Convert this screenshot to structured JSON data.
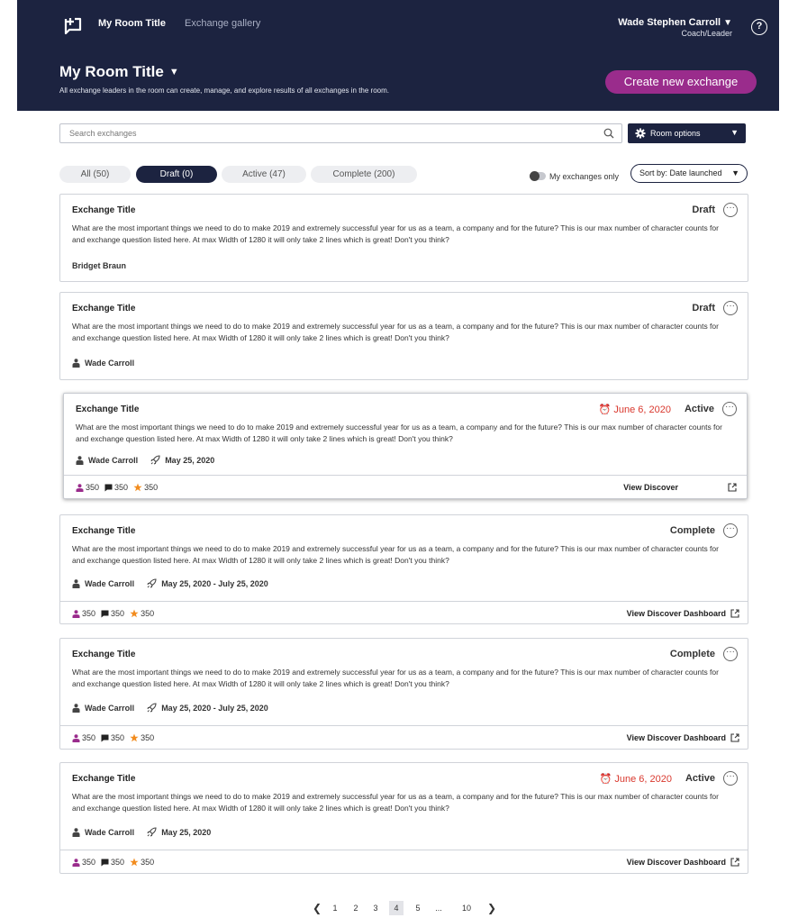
{
  "header": {
    "nav_room": "My Room Title",
    "nav_gallery": "Exchange gallery",
    "user_name": "Wade Stephen Carroll",
    "user_role": "Coach/Leader",
    "help": "?",
    "title": "My Room Title",
    "subtitle": "All exchange leaders in the room can create, manage, and explore results of all exchanges in the room.",
    "create_button": "Create new exchange"
  },
  "search": {
    "placeholder": "Search exchanges"
  },
  "room_options": "Room options",
  "tabs": [
    {
      "label": "All (50)"
    },
    {
      "label": "Draft (0)"
    },
    {
      "label": "Active (47)"
    },
    {
      "label": "Complete (200)"
    }
  ],
  "toggle_label": "My exchanges only",
  "sort_label": "Sort by: Date launched",
  "question": "What are the most important things we need to do to make 2019 and extremely successful year for us as a team, a company and for the future? This is our max number of character counts for and exchange question listed here. At max Width of 1280 it will only take 2 lines which is great! Don't you think?",
  "cards": [
    {
      "title": "Exchange Title",
      "status": "Draft",
      "author": "Bridget Braun"
    },
    {
      "title": "Exchange Title",
      "status": "Draft",
      "author": "Wade Carroll"
    },
    {
      "title": "Exchange Title",
      "status": "Active",
      "due": "June 6, 2020",
      "author": "Wade Carroll",
      "date": "May 25, 2020",
      "stats": [
        "350",
        "350",
        "350"
      ],
      "link": "View Discover"
    },
    {
      "title": "Exchange Title",
      "status": "Complete",
      "author": "Wade Carroll",
      "date": "May 25, 2020 - July 25, 2020",
      "stats": [
        "350",
        "350",
        "350"
      ],
      "link": "View Discover Dashboard"
    },
    {
      "title": "Exchange Title",
      "status": "Complete",
      "author": "Wade Carroll",
      "date": "May 25, 2020 - July 25, 2020",
      "stats": [
        "350",
        "350",
        "350"
      ],
      "link": "View Discover Dashboard"
    },
    {
      "title": "Exchange Title",
      "status": "Active",
      "due": "June 6, 2020",
      "author": "Wade Carroll",
      "date": "May 25, 2020",
      "stats": [
        "350",
        "350",
        "350"
      ],
      "link": "View Discover Dashboard"
    }
  ],
  "pagination": {
    "pages": [
      "1",
      "2",
      "3",
      "4",
      "5",
      "...",
      "10"
    ],
    "current": "4",
    "prev": "❮",
    "next": "❯"
  },
  "colors": {
    "navy": "#1c2340",
    "accent": "#9a2c8c",
    "due_red": "#d9382e",
    "star": "#f28c1e"
  }
}
